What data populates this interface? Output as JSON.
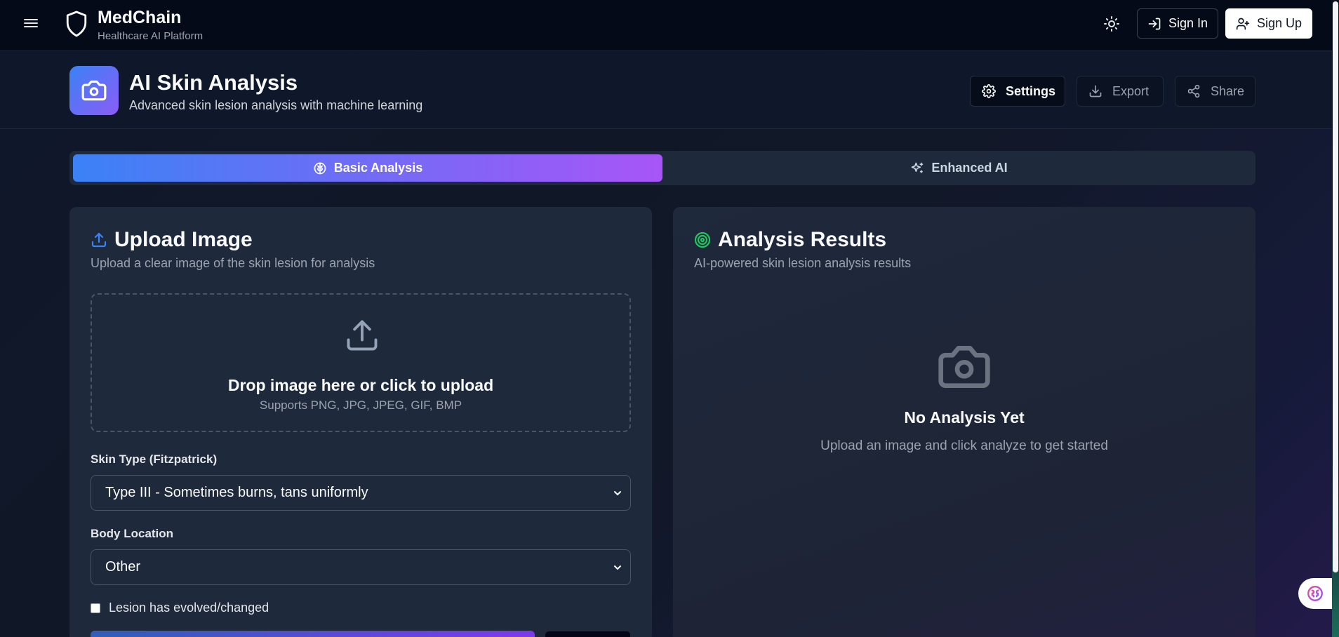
{
  "nav": {
    "brand_name": "MedChain",
    "brand_tagline": "Healthcare AI Platform",
    "sign_in_label": "Sign In",
    "sign_up_label": "Sign Up"
  },
  "header": {
    "title": "AI Skin Analysis",
    "subtitle": "Advanced skin lesion analysis with machine learning",
    "settings_label": "Settings",
    "export_label": "Export",
    "share_label": "Share"
  },
  "tabs": [
    {
      "label": "Basic Analysis",
      "active": true
    },
    {
      "label": "Enhanced AI",
      "active": false
    }
  ],
  "upload": {
    "title": "Upload Image",
    "subtitle": "Upload a clear image of the skin lesion for analysis",
    "drop_title": "Drop image here or click to upload",
    "drop_formats": "Supports PNG, JPG, JPEG, GIF, BMP",
    "skin_type_label": "Skin Type (Fitzpatrick)",
    "skin_type_value": "Type III - Sometimes burns, tans uniformly",
    "body_location_label": "Body Location",
    "body_location_value": "Other",
    "evolved_label": "Lesion has evolved/changed",
    "evolved_checked": false
  },
  "results": {
    "title": "Analysis Results",
    "subtitle": "AI-powered skin lesion analysis results",
    "empty_title": "No Analysis Yet",
    "empty_subtitle": "Upload an image and click analyze to get started"
  },
  "icons": {
    "menu": "hamburger-icon",
    "brand": "shield-icon",
    "theme": "sun-icon",
    "sign_in": "log-in-icon",
    "sign_up": "user-plus-icon",
    "hero": "camera-icon",
    "settings": "gear-icon",
    "export": "download-icon",
    "share": "share-icon",
    "basic_tab": "brain-icon",
    "enhanced_tab": "sparkles-icon",
    "upload": "upload-icon",
    "results": "target-icon",
    "assistant": "brain-icon"
  },
  "colors": {
    "accent_blue": "#3b82f6",
    "accent_purple": "#a855f7",
    "success_green": "#22c55e",
    "background": "#0f172a",
    "card": "#1e293b"
  }
}
